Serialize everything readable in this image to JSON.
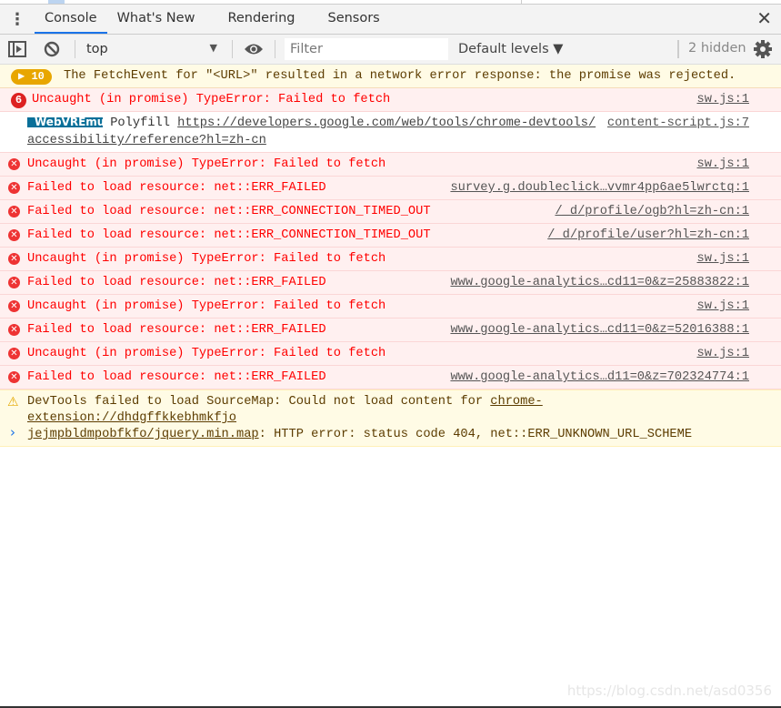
{
  "tabs": [
    {
      "label": "Console",
      "active": true
    },
    {
      "label": "What's New"
    },
    {
      "label": "Rendering"
    },
    {
      "label": "Sensors"
    }
  ],
  "toolbar": {
    "context": "top",
    "filter_placeholder": "Filter",
    "levels": "Default levels ▼",
    "hidden": "2 hidden"
  },
  "warning_group": {
    "count": "10",
    "text": "The FetchEvent for \"<URL>\" resulted in a network error response: the promise was rejected."
  },
  "error_group": {
    "count": "6",
    "text": "Uncaught (in promise) TypeError: Failed to fetch",
    "source": "sw.js:1"
  },
  "webvr": {
    "badge": "WebVREmu",
    "text": "Polyfill",
    "link1": "https://developers.google.com/web/tools/chrome-devtools/",
    "link2": "accessibility/reference?hl=zh-cn",
    "source": "content-script.js:7"
  },
  "errors": [
    {
      "text": "Uncaught (in promise) TypeError: Failed to fetch",
      "source": "sw.js:1"
    },
    {
      "text": "Failed to load resource: net::ERR_FAILED",
      "source": "survey.g.doubleclick…vvmr4pp6ae5lwrctq:1"
    },
    {
      "text": "Failed to load resource: net::ERR_CONNECTION_TIMED_OUT",
      "source": "/_d/profile/ogb?hl=zh-cn:1"
    },
    {
      "text": "Failed to load resource: net::ERR_CONNECTION_TIMED_OUT",
      "source": "/_d/profile/user?hl=zh-cn:1"
    },
    {
      "text": "Uncaught (in promise) TypeError: Failed to fetch",
      "source": "sw.js:1"
    },
    {
      "text": "Failed to load resource: net::ERR_FAILED",
      "source": "www.google-analytics…cd11=0&z=25883822:1"
    },
    {
      "text": "Uncaught (in promise) TypeError: Failed to fetch",
      "source": "sw.js:1"
    },
    {
      "text": "Failed to load resource: net::ERR_FAILED",
      "source": "www.google-analytics…cd11=0&z=52016388:1"
    },
    {
      "text": "Uncaught (in promise) TypeError: Failed to fetch",
      "source": "sw.js:1"
    },
    {
      "text": "Failed to load resource: net::ERR_FAILED",
      "source": "www.google-analytics…d11=0&z=702324774:1"
    }
  ],
  "sourcemap": {
    "text1": "DevTools failed to load SourceMap: Could not load content for ",
    "link1": "chrome-extension://dhdgffkkebhmkfjo",
    "link2": "jejmpbldmpobfkfo/jquery.min.map",
    "text2": ": HTTP error: status code 404, net::ERR_UNKNOWN_URL_SCHEME"
  },
  "prompt": "›",
  "watermark": "https://blog.csdn.net/asd0356",
  "colors": {
    "error_bg": "#fff0f0",
    "error_text": "#ff0000",
    "warning_bg": "#fffbe5",
    "accent": "#1a73e8"
  }
}
